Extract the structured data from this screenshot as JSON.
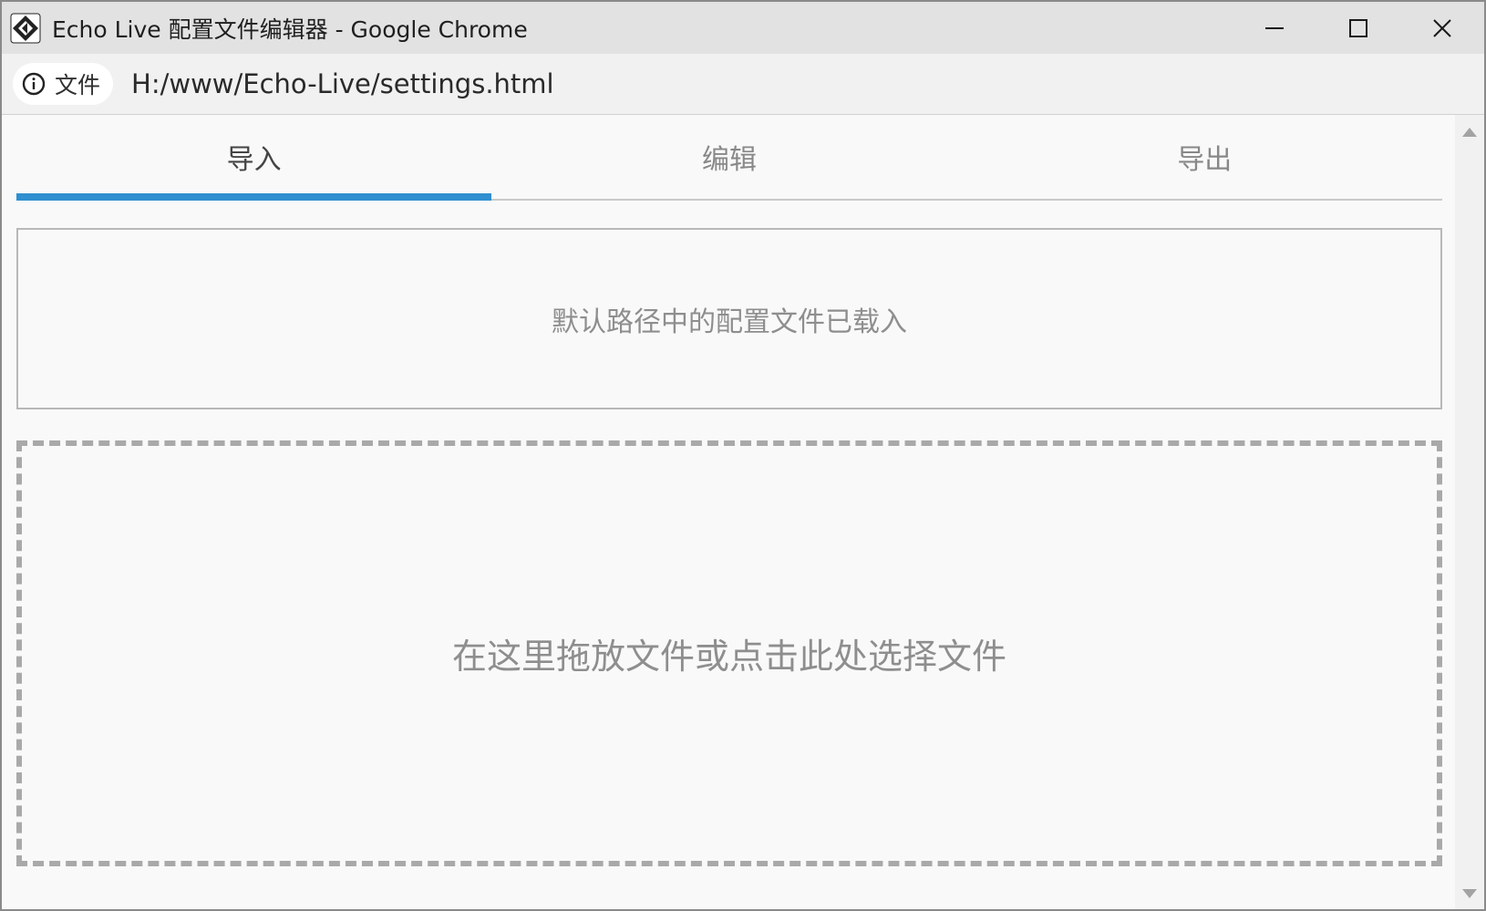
{
  "window": {
    "title": "Echo Live 配置文件编辑器 - Google Chrome",
    "app_icon": "echo-live-logo-icon",
    "controls": [
      "minimize-icon",
      "maximize-icon",
      "close-icon"
    ]
  },
  "addressbar": {
    "info_icon": "info-icon",
    "chip_label": "文件",
    "url": "H:/www/Echo-Live/settings.html"
  },
  "tabs": [
    {
      "label": "导入",
      "active": true
    },
    {
      "label": "编辑",
      "active": false
    },
    {
      "label": "导出",
      "active": false
    }
  ],
  "status_message": "默认路径中的配置文件已载入",
  "drop_zone_text": "在这里拖放文件或点击此处选择文件",
  "colors": {
    "accent": "#2f8fd0",
    "muted_text": "#8e8e8e",
    "border": "#a9a9a9"
  }
}
